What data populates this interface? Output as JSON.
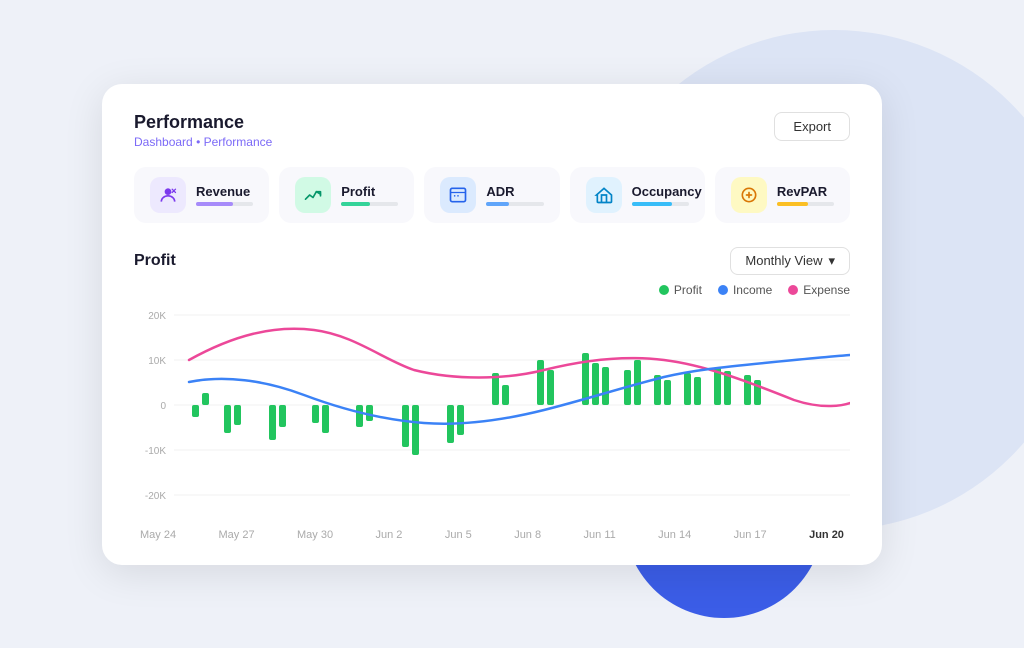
{
  "page": {
    "background_circle_color": "#dce4f5",
    "background_circle_blue": "#3b5de7"
  },
  "card": {
    "title": "Performance",
    "breadcrumb_root": "Dashboard",
    "breadcrumb_separator": "•",
    "breadcrumb_current": "Performance",
    "export_label": "Export"
  },
  "metrics": [
    {
      "id": "revenue",
      "label": "Revenue",
      "icon_type": "purple",
      "bar_color": "#a78bfa",
      "bar_pct": 65
    },
    {
      "id": "profit",
      "label": "Profit",
      "icon_type": "green",
      "bar_color": "#34d399",
      "bar_pct": 50
    },
    {
      "id": "adr",
      "label": "ADR",
      "icon_type": "blue",
      "bar_color": "#60a5fa",
      "bar_pct": 40
    },
    {
      "id": "occupancy",
      "label": "Occupancy",
      "icon_type": "sky",
      "bar_color": "#38bdf8",
      "bar_pct": 70
    },
    {
      "id": "revpar",
      "label": "RevPAR",
      "icon_type": "yellow",
      "bar_color": "#fbbf24",
      "bar_pct": 55
    }
  ],
  "chart": {
    "title": "Profit",
    "view_label": "Monthly View",
    "legend": [
      {
        "name": "Profit",
        "color": "#22c55e"
      },
      {
        "name": "Income",
        "color": "#3b82f6"
      },
      {
        "name": "Expense",
        "color": "#ec4899"
      }
    ],
    "y_labels": [
      "20K",
      "10K",
      "0",
      "-10K",
      "-20K"
    ],
    "x_labels": [
      "May 24",
      "May 27",
      "May 30",
      "Jun 2",
      "Jun 5",
      "Jun 8",
      "Jun 11",
      "Jun 14",
      "Jun 17",
      "Jun 20"
    ]
  }
}
